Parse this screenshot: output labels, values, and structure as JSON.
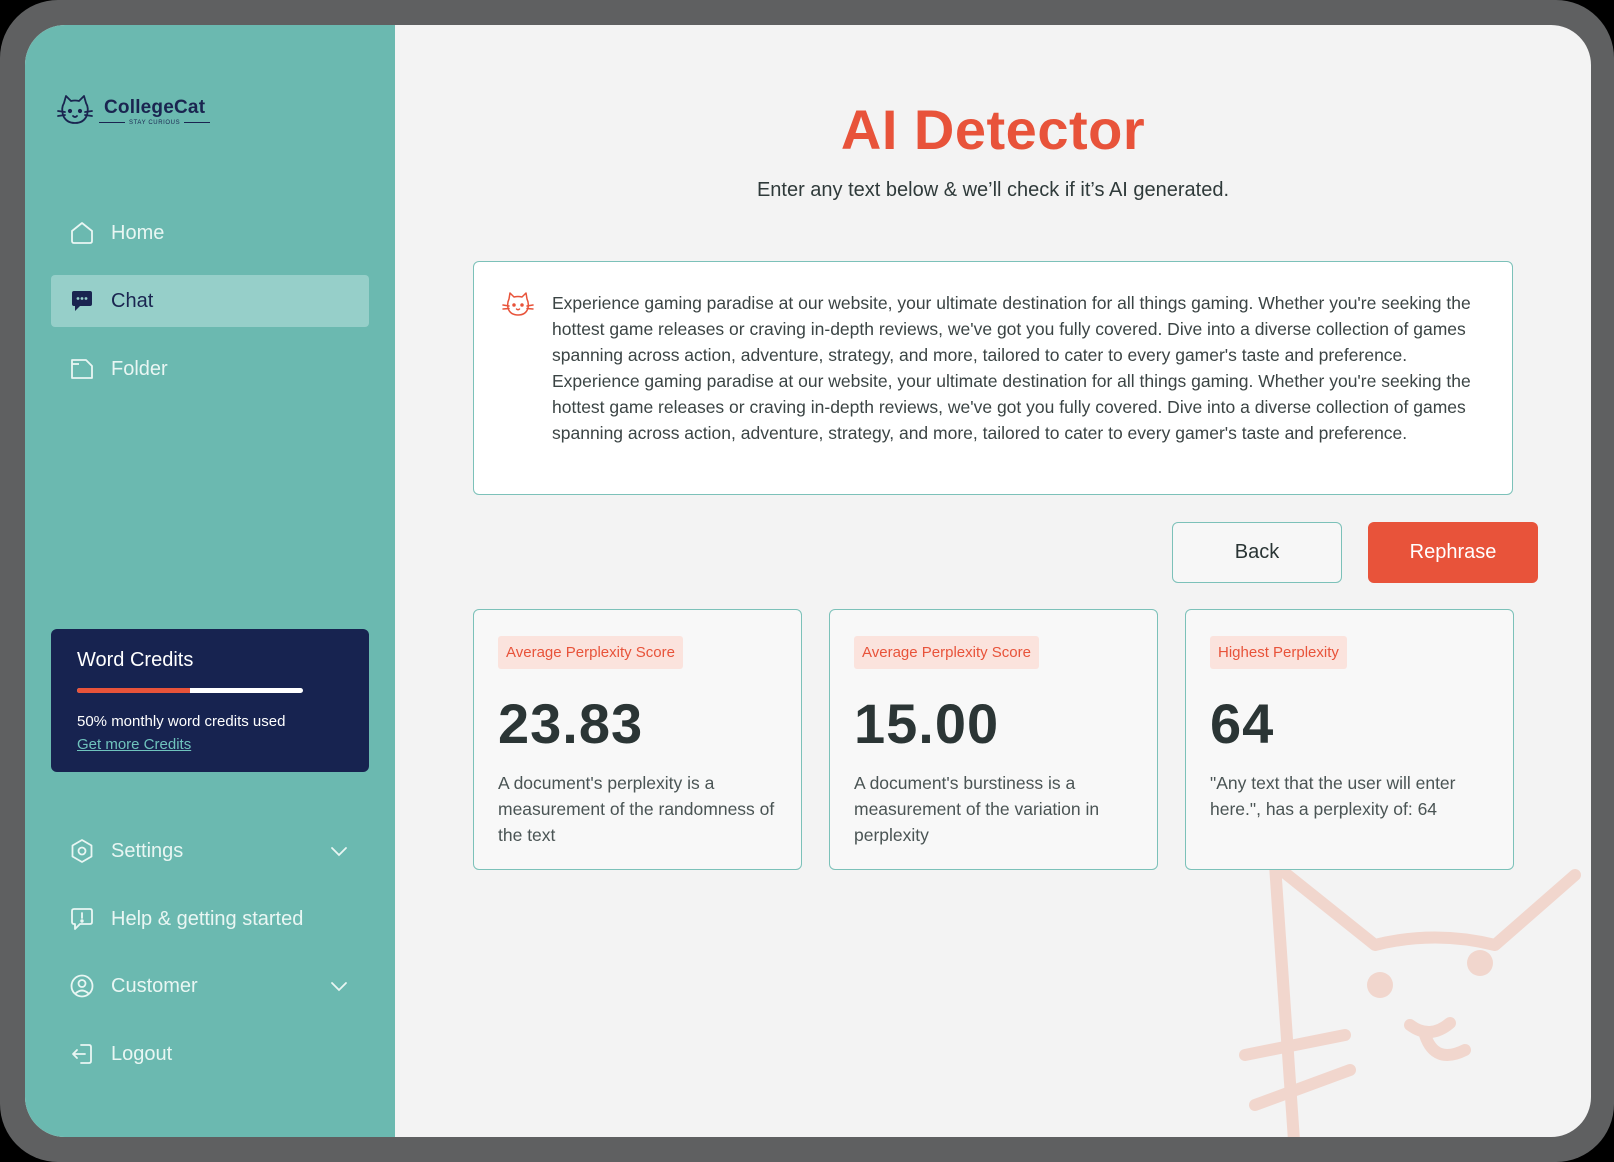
{
  "brand": {
    "name": "CollegeCat",
    "tagline": "STAY CURIOUS"
  },
  "sidebar": {
    "items": [
      {
        "label": "Home",
        "icon": "home-icon",
        "active": false
      },
      {
        "label": "Chat",
        "icon": "chat-icon",
        "active": true
      },
      {
        "label": "Folder",
        "icon": "folder-icon",
        "active": false
      }
    ],
    "bottom_items": [
      {
        "label": "Settings",
        "icon": "settings-icon",
        "expandable": true
      },
      {
        "label": "Help & getting started",
        "icon": "help-icon",
        "expandable": false
      },
      {
        "label": "Customer",
        "icon": "customer-icon",
        "expandable": true
      },
      {
        "label": "Logout",
        "icon": "logout-icon",
        "expandable": false
      }
    ]
  },
  "credits": {
    "title": "Word Credits",
    "used_fraction": 0.5,
    "text": "50% monthly word credits used",
    "link": "Get more Credits"
  },
  "main": {
    "title": "AI Detector",
    "subtitle": "Enter any text below & we’ll check if it’s AI generated.",
    "input_text": "Experience gaming paradise at our website, your ultimate destination for all things gaming. Whether you're seeking the hottest game releases or craving in-depth reviews, we've got you fully covered. Dive into a diverse collection of games spanning across action, adventure, strategy, and more, tailored to cater to every gamer's taste and preference. Experience gaming paradise at our website, your ultimate destination for all things gaming. Whether you're seeking the hottest game releases or craving in-depth reviews, we've got you fully covered. Dive into a diverse collection of games spanning across action, adventure, strategy, and more, tailored to cater to every gamer's taste and preference.",
    "back_label": "Back",
    "rephrase_label": "Rephrase",
    "stats": [
      {
        "badge": "Average Perplexity Score",
        "value": "23.83",
        "description": "A document's perplexity is a measurement of the randomness of the text"
      },
      {
        "badge": "Average Perplexity Score",
        "value": "15.00",
        "description": "A document's burstiness is a measurement of the variation in perplexity"
      },
      {
        "badge": "Highest Perplexity",
        "value": "64",
        "description": "\"Any text that the user will enter here.\", has a perplexity of: 64"
      }
    ]
  },
  "colors": {
    "sidebar": "#6bb9b0",
    "accent": "#e8533a",
    "navy": "#172350",
    "border": "#7cc1b9"
  }
}
